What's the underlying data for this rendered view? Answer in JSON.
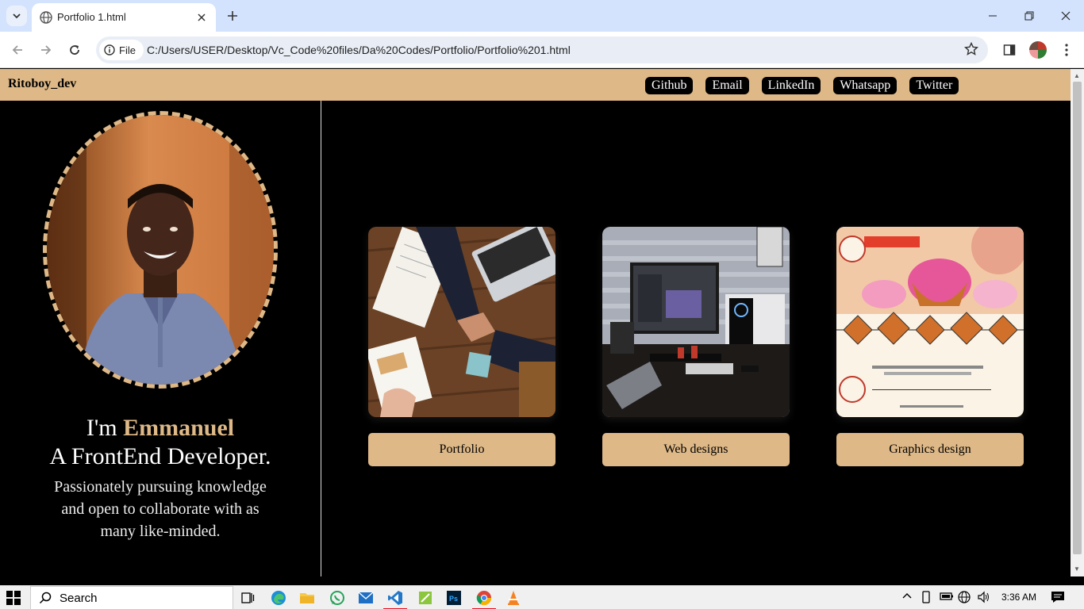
{
  "browser": {
    "tab_title": "Portfolio 1.html",
    "site_chip": "File",
    "url": "C:/Users/USER/Desktop/Vc_Code%20files/Da%20Codes/Portfolio/Portfolio%201.html"
  },
  "page": {
    "brand": "Ritoboy_dev",
    "nav_links": [
      "Github",
      "Email",
      "LinkedIn",
      "Whatsapp",
      "Twitter"
    ],
    "intro": {
      "prefix": "I'm ",
      "name": "Emmanuel",
      "role": "A FrontEnd Developer.",
      "description": "Passionately pursuing knowledge and open to collaborate with as many like-minded."
    },
    "cards": [
      {
        "label": "Portfolio"
      },
      {
        "label": "Web designs"
      },
      {
        "label": "Graphics design"
      }
    ],
    "accent_color": "#deb887"
  },
  "taskbar": {
    "search_label": "Search",
    "time": "3:36 AM"
  }
}
